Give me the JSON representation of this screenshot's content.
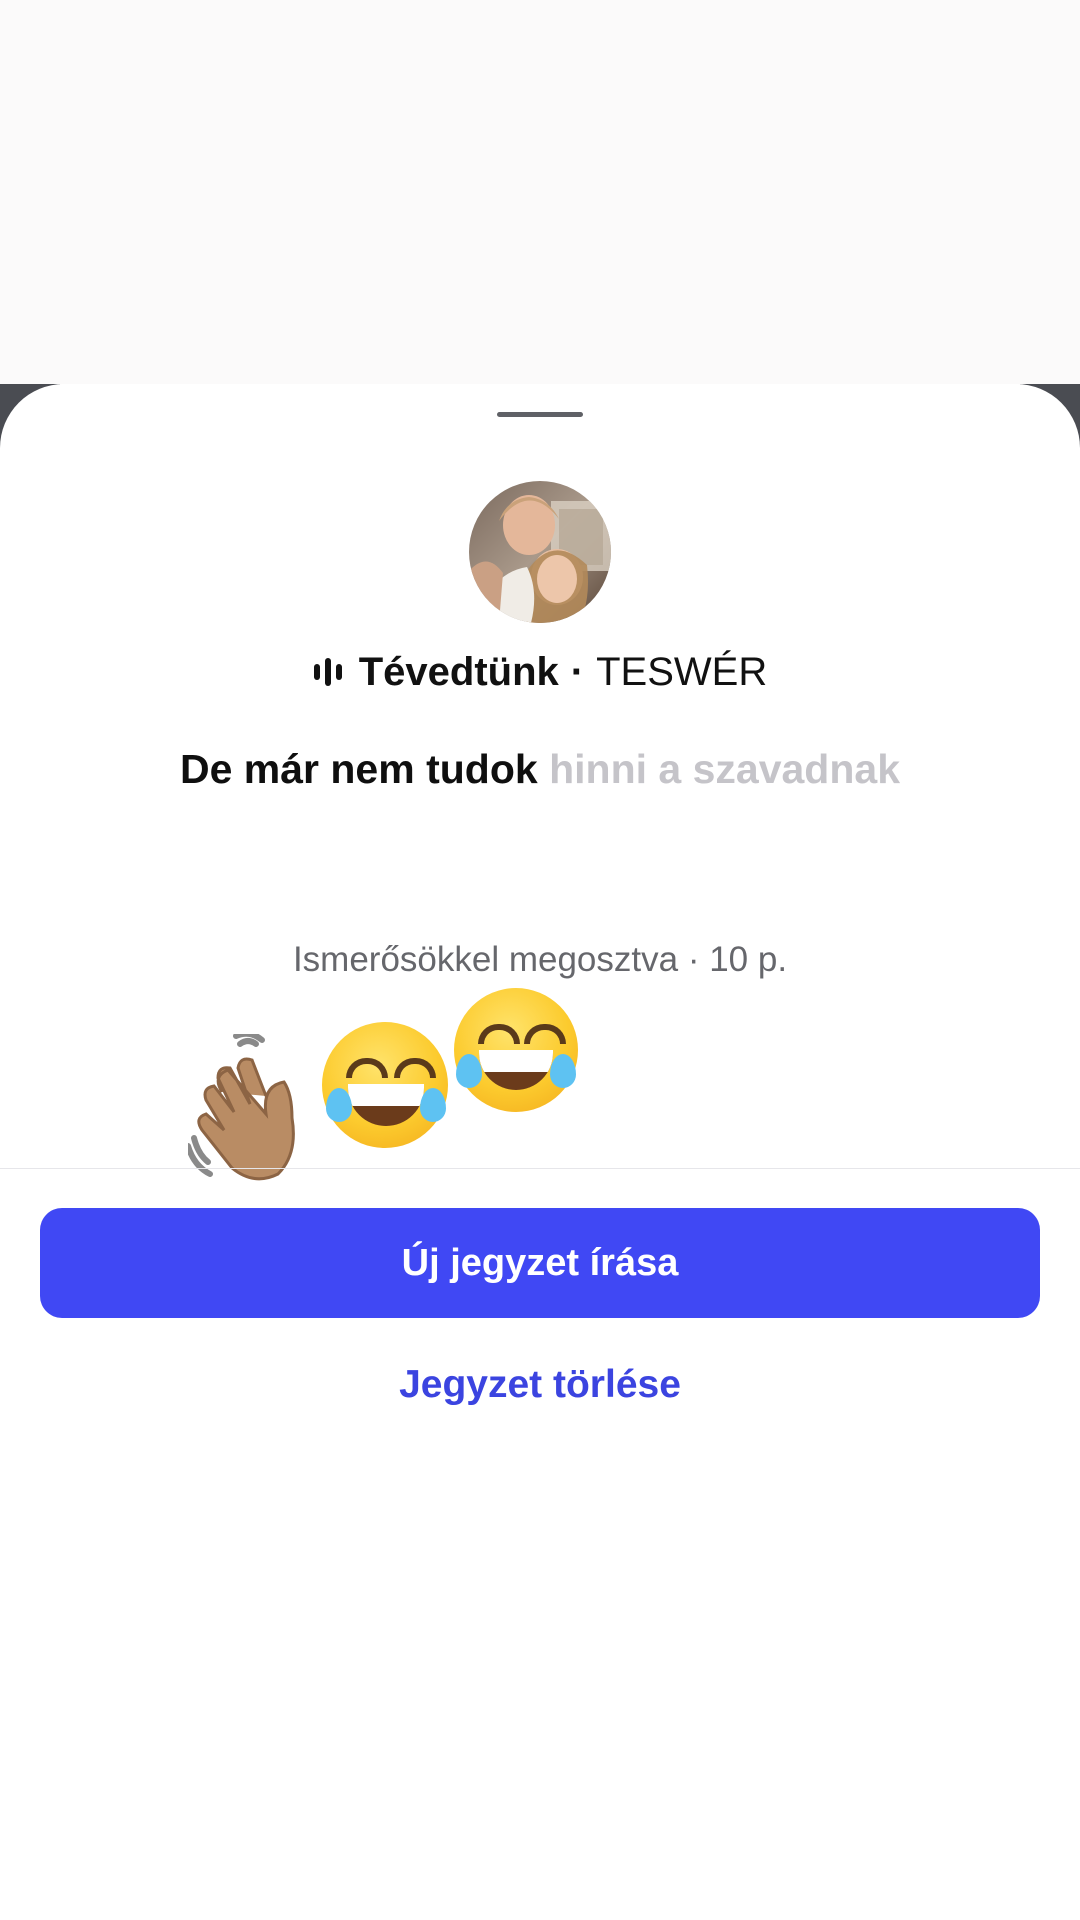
{
  "note": {
    "song_title": "Tévedtünk",
    "separator": "·",
    "song_artist": "TESWÉR",
    "lyric_sung": "De már nem tudok",
    "lyric_pending": "hinni a szavadnak",
    "share_info": "Ismerősökkel megosztva · 10 p."
  },
  "reactions": [
    {
      "emoji": "waving-hand-medium-skin-tone"
    },
    {
      "emoji": "face-with-tears-of-joy"
    },
    {
      "emoji": "face-with-tears-of-joy"
    }
  ],
  "actions": {
    "new_note_label": "Új jegyzet írása",
    "delete_note_label": "Jegyzet törlése"
  },
  "colors": {
    "primary_button": "#4048f4",
    "delete_text": "#3b44e0",
    "lyric_pending": "#c5c4c9",
    "meta_text": "#66676c"
  },
  "icons": {
    "music": "audio-bars-icon",
    "avatar": "profile-photo"
  }
}
